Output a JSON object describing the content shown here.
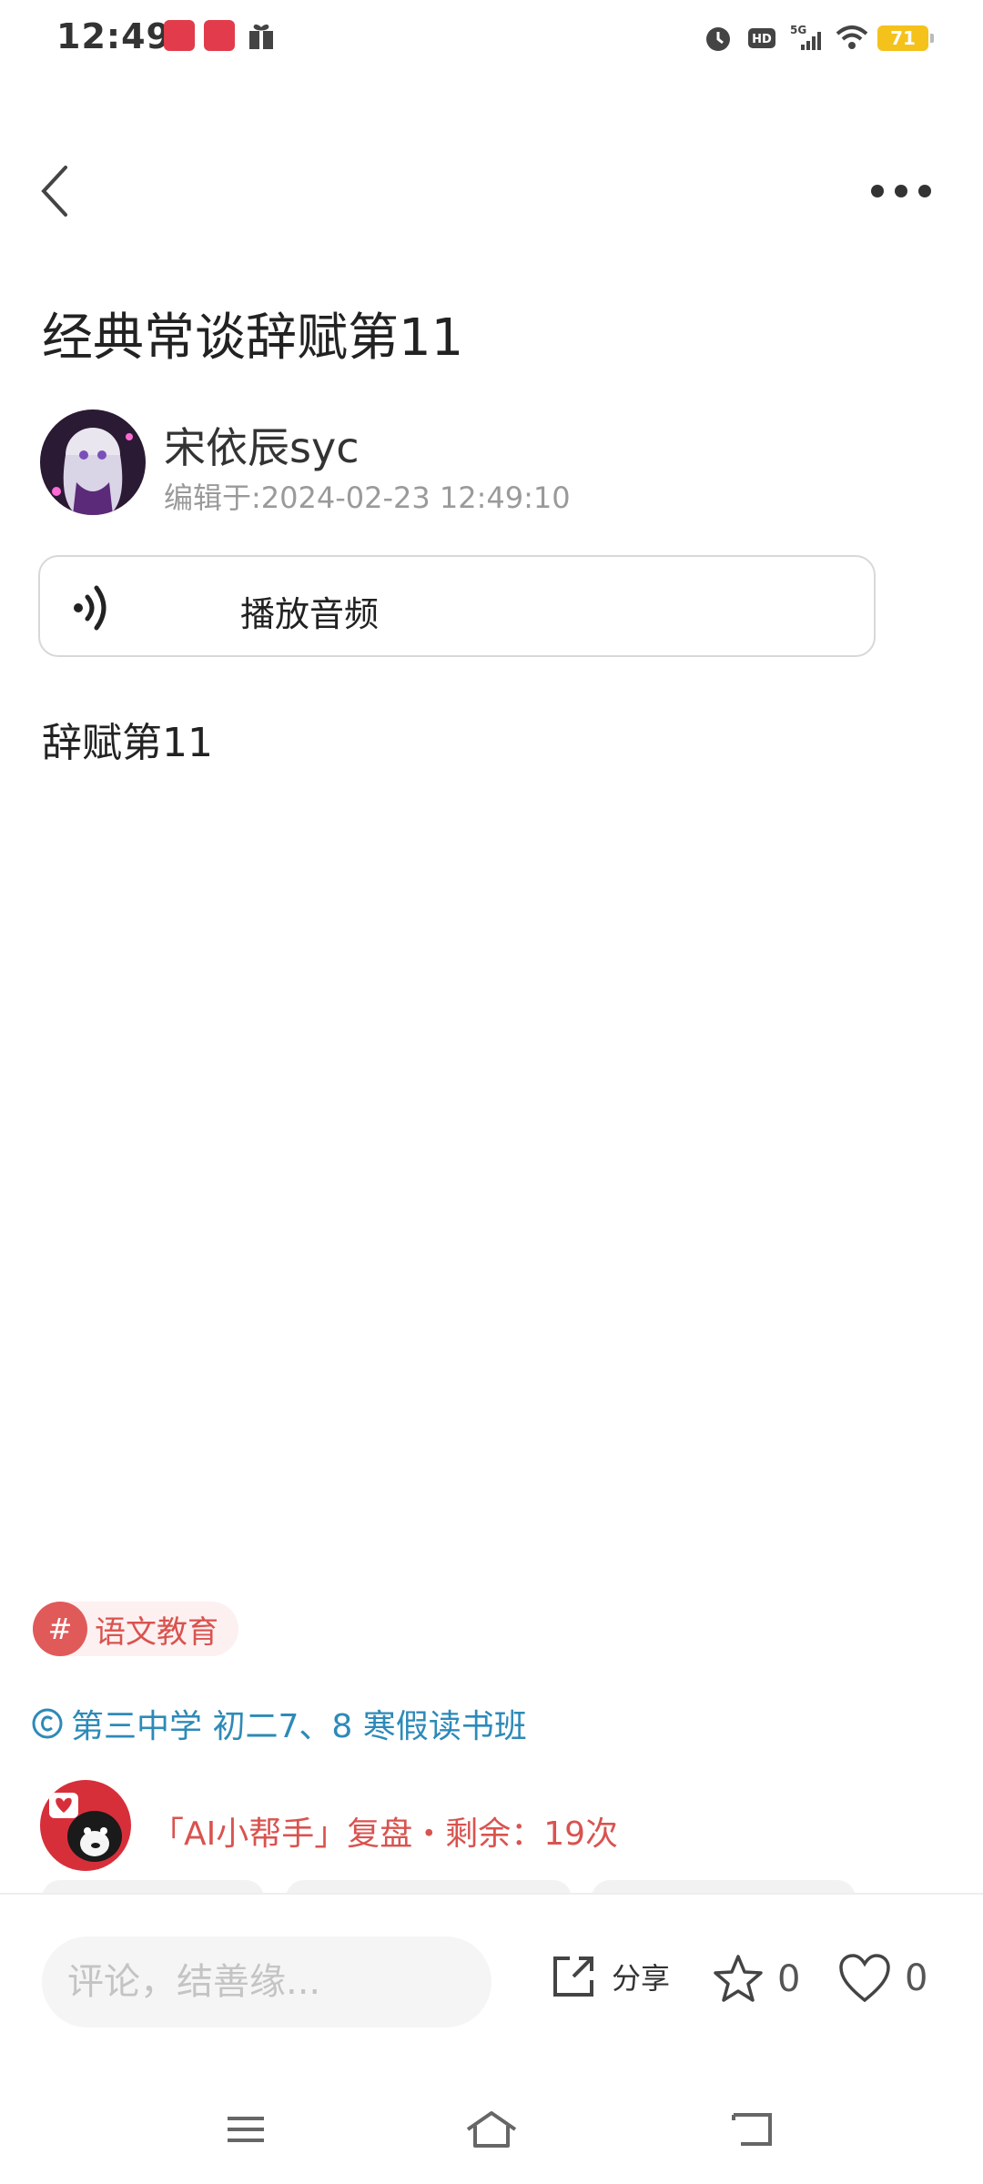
{
  "status_bar": {
    "time": "12:49",
    "battery": "71",
    "icons": [
      "alarm-icon",
      "hd-icon",
      "signal-5g-icon",
      "wifi-icon",
      "battery-icon"
    ]
  },
  "header": {
    "back_icon": "chevron-left-icon",
    "more_icon": "more-horizontal-icon"
  },
  "article": {
    "title": "经典常谈辞赋第11",
    "author": "宋依辰syc",
    "edit_time": "编辑于:2024-02-23 12:49:10",
    "audio_label": "播放音频",
    "body": "辞赋第11"
  },
  "topic": {
    "hash": "#",
    "label": "语文教育"
  },
  "class_link": {
    "label": "第三中学 初二7、8 寒假读书班"
  },
  "ai_helper": {
    "text": "「AI小帮手」复盘・剩余：19次"
  },
  "bottom_bar": {
    "comment_placeholder": "评论，结善缘...",
    "share_label": "分享",
    "favorite_count": "0",
    "like_count": "0"
  },
  "colors": {
    "accent_red": "#d9534f",
    "link_blue": "#2d8ab8",
    "battery_yellow": "#f4c21b"
  }
}
